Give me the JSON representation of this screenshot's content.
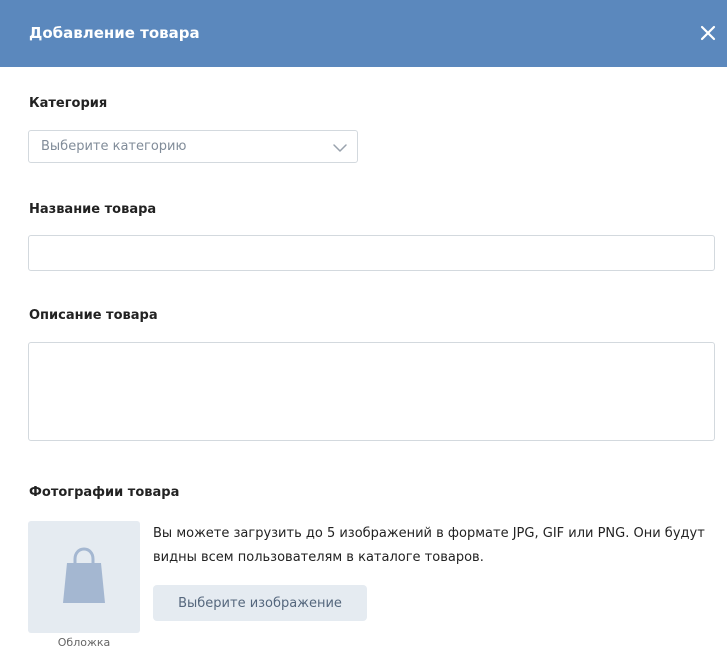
{
  "header": {
    "title": "Добавление товара",
    "close_icon": "close-icon"
  },
  "category": {
    "label": "Категория",
    "select_value": "Выберите категорию",
    "chevron_icon": "chevron-down-icon"
  },
  "name": {
    "label": "Название товара",
    "value": ""
  },
  "description": {
    "label": "Описание товара",
    "value": ""
  },
  "photos": {
    "label": "Фотографии товара",
    "info": "Вы можете загрузить до 5 изображений в формате JPG, GIF или PNG. Они будут видны всем пользователям в каталоге товаров.",
    "upload_button": "Выберите изображение",
    "cover_label": "Обложка",
    "placeholder_icon": "shopping-bag-icon"
  },
  "colors": {
    "header_bg": "#5b88bd",
    "placeholder_bg": "#e5ebf1",
    "bag_icon": "#a4b7d1",
    "border": "#d3d9de"
  }
}
